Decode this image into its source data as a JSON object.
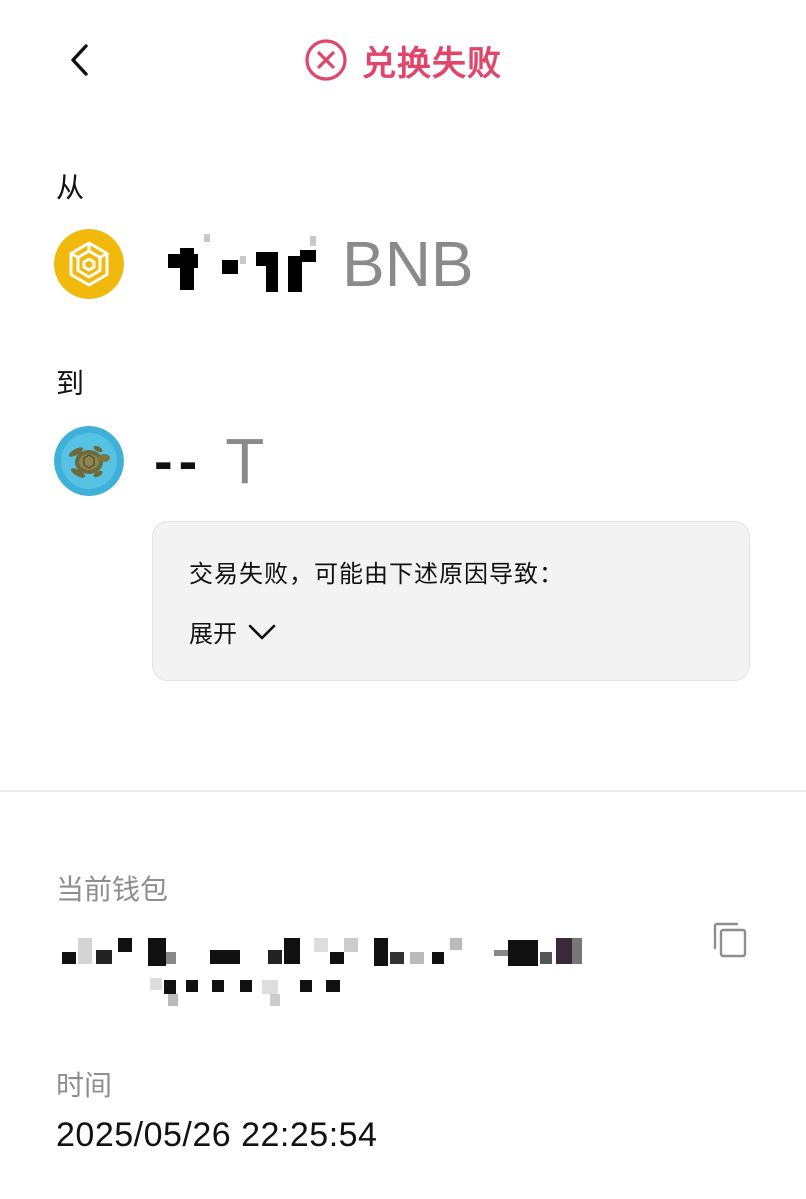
{
  "header": {
    "title": "兑换失败",
    "status_color": "#e0456b",
    "back_icon": "chevron-left-icon",
    "status_icon": "circle-x-icon"
  },
  "swap": {
    "from_label": "从",
    "from_symbol": "BNB",
    "from_icon": "bnb-coin-icon",
    "to_label": "到",
    "to_amount": "--",
    "to_symbol": "T",
    "to_icon": "turtle-token-icon"
  },
  "failure": {
    "reason_text": "交易失败，可能由下述原因导致：",
    "expand_label": "展开",
    "expand_icon": "chevron-down-icon"
  },
  "wallet": {
    "label": "当前钱包",
    "copy_icon": "copy-icon"
  },
  "time": {
    "label": "时间",
    "value": "2025/05/26 22:25:54"
  }
}
